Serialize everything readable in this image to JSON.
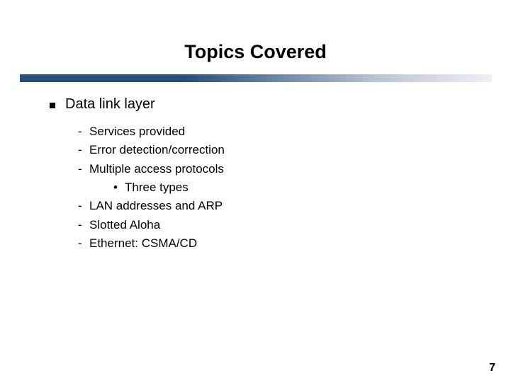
{
  "title": "Topics Covered",
  "bullet": {
    "label": "Data link layer",
    "items": [
      {
        "text": "Services provided"
      },
      {
        "text": "Error detection/correction"
      },
      {
        "text": "Multiple access protocols"
      },
      {
        "text": "Three types",
        "sub": true
      },
      {
        "text": "LAN addresses and ARP"
      },
      {
        "text": "Slotted Aloha"
      },
      {
        "text": "Ethernet: CSMA/CD"
      }
    ]
  },
  "page_number": "7"
}
